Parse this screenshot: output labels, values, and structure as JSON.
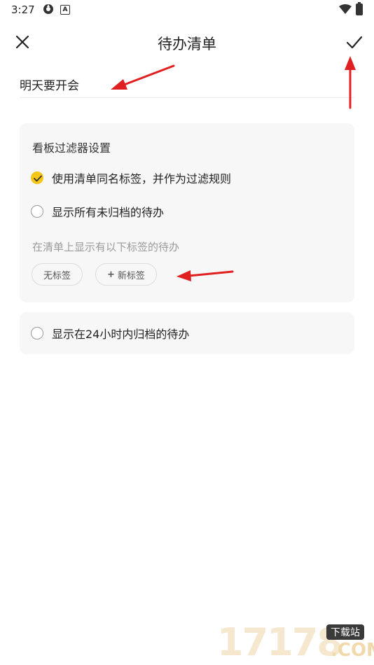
{
  "status_bar": {
    "time": "3:27",
    "icons": [
      "sync-icon",
      "a-notification-icon",
      "wifi-icon",
      "battery-icon"
    ]
  },
  "app_bar": {
    "title": "待办清单",
    "close_icon": "close-icon",
    "confirm_icon": "check-icon"
  },
  "name_field": {
    "value": "明天要开会"
  },
  "filter_settings": {
    "title": "看板过滤器设置",
    "options": [
      {
        "label": "使用清单同名标签，并作为过滤规则",
        "checked": true
      },
      {
        "label": "显示所有未归档的待办",
        "checked": false
      }
    ],
    "tag_hint": "在清单上显示有以下标签的待办",
    "tags": [
      "无标签"
    ],
    "new_tag_label": "新标签",
    "new_tag_prefix": "+"
  },
  "archive_option": {
    "label": "显示在24小时内归档的待办",
    "checked": false
  },
  "colors": {
    "accent": "#f5c518",
    "annotation_arrow": "#e02020",
    "card_bg": "#f7f7f7"
  },
  "watermark": {
    "number": "17178",
    "badge": "下载站",
    "suffix": ".COM"
  }
}
